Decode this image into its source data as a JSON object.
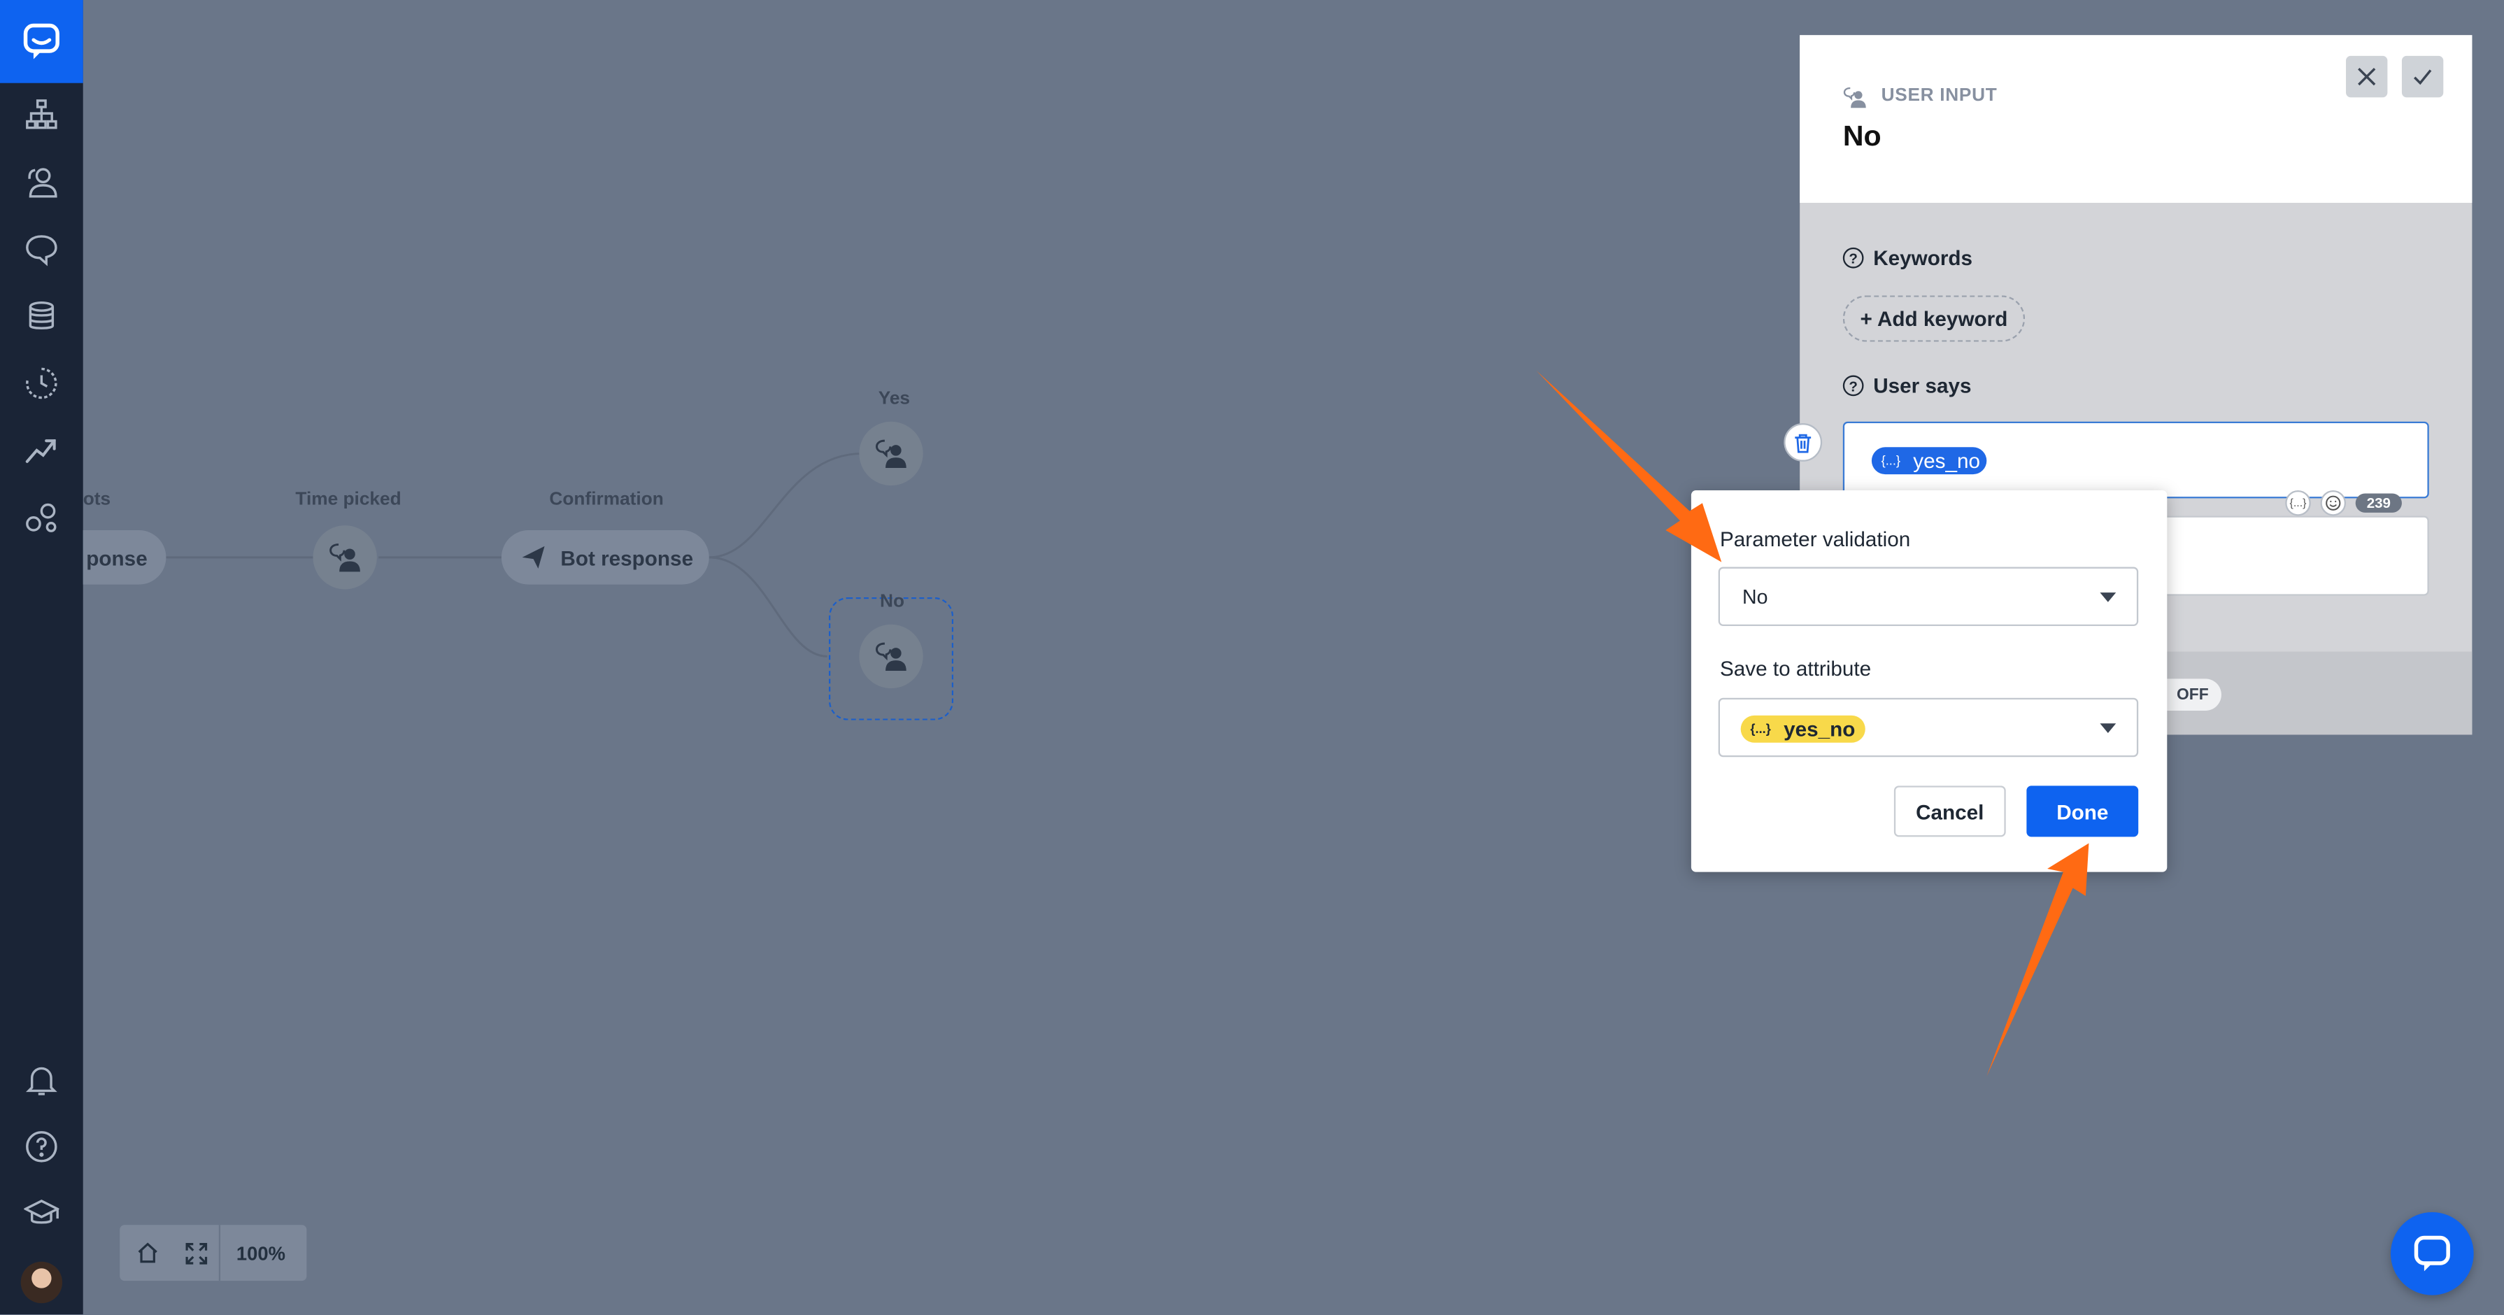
{
  "canvas": {
    "nodes": {
      "partial_label": "ots",
      "partial_pill": "ponse",
      "time_picked": "Time picked",
      "confirmation": "Confirmation",
      "bot_response": "Bot response",
      "yes": "Yes",
      "no": "No"
    },
    "zoom": "100%"
  },
  "panel": {
    "kind": "USER INPUT",
    "title": "No",
    "keywords_label": "Keywords",
    "add_keyword": "+ Add keyword",
    "user_says_label": "User says",
    "user_says_chip": "yes_no",
    "brace_icon_text": "{...}",
    "char_counter": "239",
    "toggle_label": "OFF"
  },
  "popup": {
    "parameter_validation_label": "Parameter validation",
    "parameter_validation_value": "No",
    "save_to_attribute_label": "Save to attribute",
    "save_to_attribute_value": "yes_no",
    "brace_icon_text": "{...}",
    "cancel": "Cancel",
    "done": "Done"
  },
  "colors": {
    "accent": "#0e63f0",
    "sidebar": "#1a2436",
    "overlay": "#6a7689",
    "annotation_arrow": "#ff6a13",
    "chip_yellow": "#f8d94a"
  }
}
